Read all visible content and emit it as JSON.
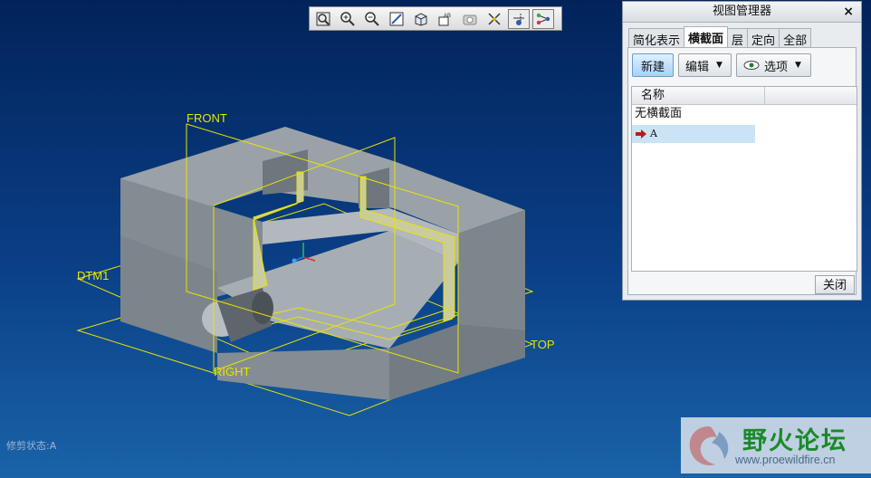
{
  "viewport": {
    "datum_labels": {
      "front": "FRONT",
      "dtm1": "DTM1",
      "right": "RIGHT",
      "top": "TOP"
    }
  },
  "toolbar": {
    "buttons": [
      "refit-icon",
      "zoom-in-icon",
      "zoom-out-icon",
      "repaint-icon",
      "orient-icon",
      "saved-views-icon",
      "spin-center-icon",
      "datum-planes-icon",
      "datum-axes-icon",
      "datum-points-icon"
    ]
  },
  "view_manager": {
    "title": "视图管理器",
    "close_x": "×",
    "tabs": [
      {
        "label": "简化表示"
      },
      {
        "label": "横截面"
      },
      {
        "label": "层"
      },
      {
        "label": "定向"
      },
      {
        "label": "全部"
      }
    ],
    "active_tab": "横截面",
    "new_button": "新建",
    "edit_button": "编辑",
    "options_button": "选项",
    "list_header": "名称",
    "items": [
      "无横截面",
      "A"
    ],
    "selected_item": "A",
    "close_button": "关闭"
  },
  "status_text": "修剪状态:A",
  "watermark": {
    "title": "野火论坛",
    "url": "www.proewildfire.cn"
  },
  "colors": {
    "datum": "#e8e400",
    "model": "#8e979e",
    "selection": "#cbe4f5",
    "background_top": "#02235a",
    "background_bottom": "#1a63a8"
  }
}
